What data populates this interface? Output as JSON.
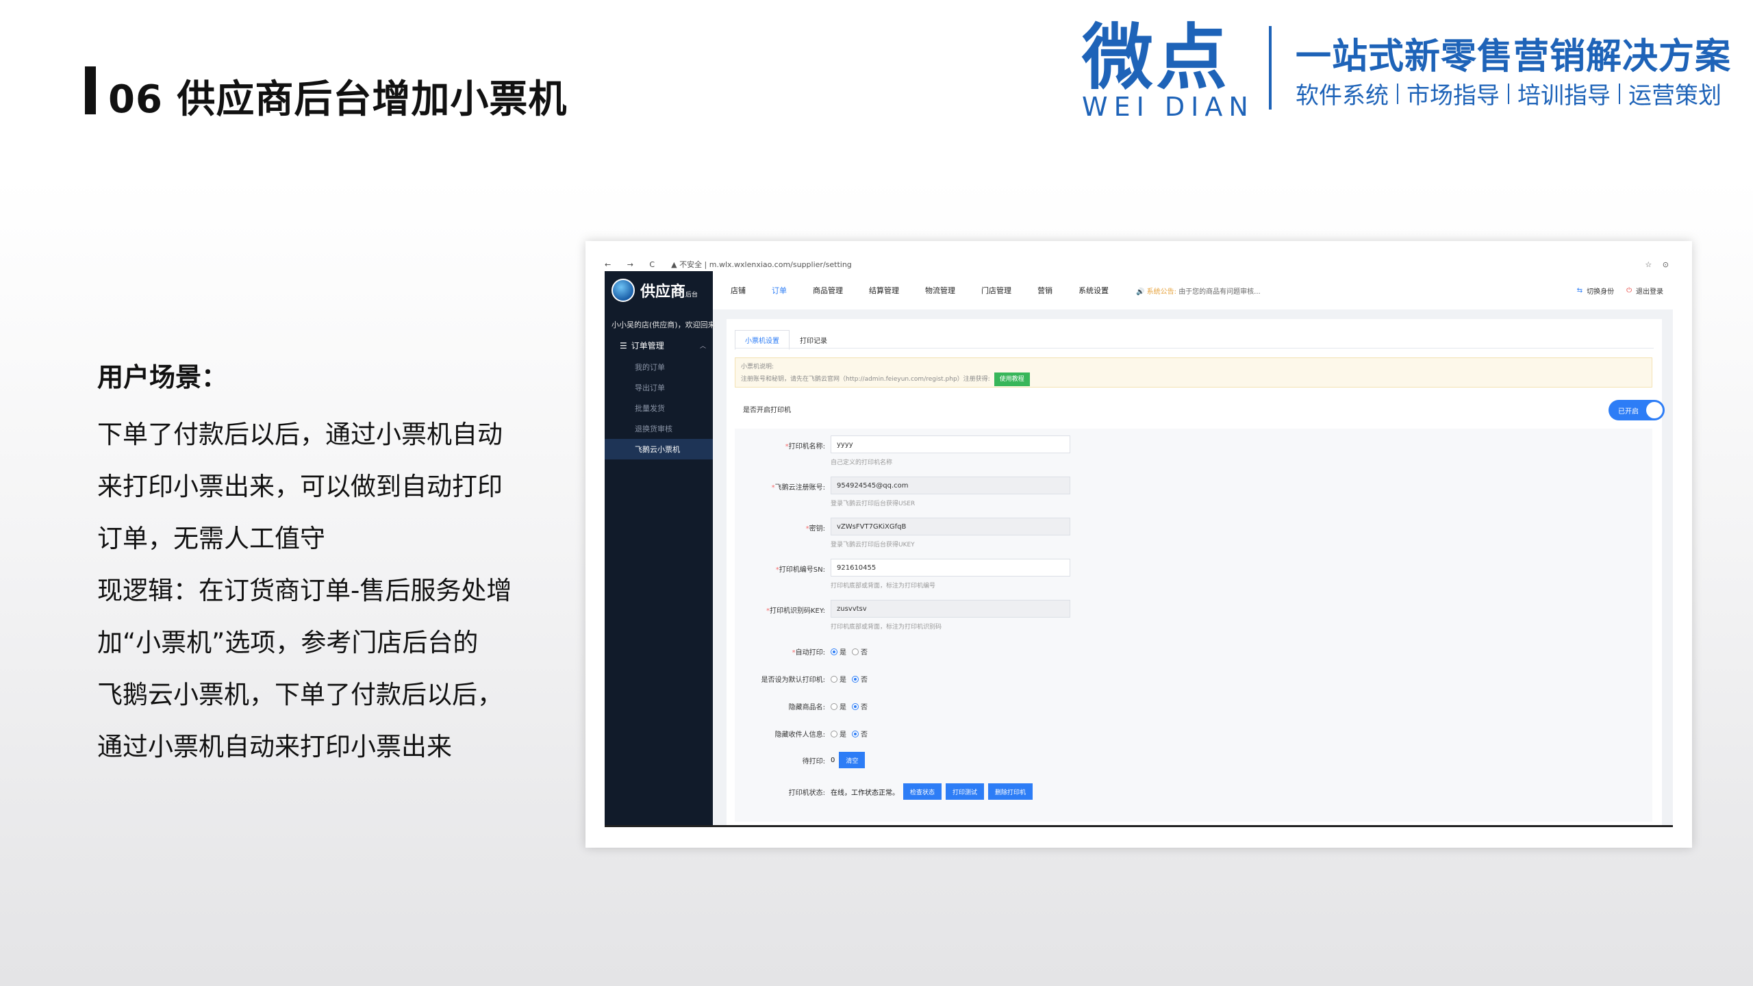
{
  "slide": {
    "title": "06 供应商后台增加小票机",
    "brand_cn": "微点",
    "brand_en": "WEI DIAN",
    "tagline": "一站式新零售营销解决方案",
    "subtags": [
      "软件系统",
      "市场指导",
      "培训指导",
      "运营策划"
    ]
  },
  "copy": {
    "heading": "用户场景：",
    "paragraphs": [
      "下单了付款后以后，通过小票机自动",
      "来打印小票出来，可以做到自动打印",
      "订单，无需人工值守",
      "现逻辑：在订货商订单-售后服务处增",
      "加“小票机”选项，参考门店后台的",
      "飞鹅云小票机，下单了付款后以后，",
      "通过小票机自动来打印小票出来"
    ]
  },
  "browser": {
    "nav": "← → C",
    "url": "▲ 不安全 | m.wlx.wxlenxiao.com/supplier/setting",
    "right": "☆ ⊙"
  },
  "app": {
    "logo_name": "供应商",
    "logo_small": "后台",
    "welcome": "小小吴的店(供应商)，欢迎回来",
    "sidebar_group": "订单管理",
    "sidebar_items": [
      "我的订单",
      "导出订单",
      "批量发货",
      "退换货审核",
      "飞鹅云小票机"
    ],
    "active_sidebar_index": 4,
    "topnav": [
      "店铺",
      "订单",
      "商品管理",
      "结算管理",
      "物流管理",
      "门店管理",
      "营销",
      "系统设置"
    ],
    "active_topnav_index": 1,
    "notice_label": "🔊 系统公告:",
    "notice_text": "由于您的商品有问题审核...",
    "switch_identity": "切换身份",
    "logout": "退出登录",
    "tabs": [
      "小票机设置",
      "打印记录"
    ],
    "info_title": "小票机说明:",
    "info_text": "注册账号和秘钥，请先在飞鹅云官网（http://admin.feieyun.com/regist.php）注册获得:",
    "info_button": "使用教程",
    "enable_label": "是否开启打印机",
    "toggle_text": "已开启",
    "fields": [
      {
        "label": "打印机名称:",
        "value": "yyyy",
        "hint": "自己定义的打印机名称",
        "disabled": false
      },
      {
        "label": "飞鹅云注册账号:",
        "value": "954924545@qq.com",
        "hint": "登录飞鹅云打印后台获得USER",
        "disabled": true
      },
      {
        "label": "密钥:",
        "value": "vZWsFVT7GKiXGfqB",
        "hint": "登录飞鹅云打印后台获得UKEY",
        "disabled": true
      },
      {
        "label": "打印机编号SN:",
        "value": "921610455",
        "hint": "打印机底部或背面，标注为打印机编号",
        "disabled": false
      },
      {
        "label": "打印机识别码KEY:",
        "value": "zusvvtsv",
        "hint": "打印机底部或背面，标注为打印机识别码",
        "disabled": true
      }
    ],
    "radios": [
      {
        "label": "自动打印:",
        "yes": "是",
        "no": "否",
        "selected": "yes"
      },
      {
        "label": "是否设为默认打印机:",
        "yes": "是",
        "no": "否",
        "selected": "no"
      },
      {
        "label": "隐藏商品名:",
        "yes": "是",
        "no": "否",
        "selected": "no"
      },
      {
        "label": "隐藏收件人信息:",
        "yes": "是",
        "no": "否",
        "selected": "no"
      }
    ],
    "pending_label": "待打印:",
    "pending_count": "0",
    "clear_button": "清空",
    "status_label": "打印机状态:",
    "status_text": "在线，工作状态正常。",
    "status_buttons": [
      "检查状态",
      "打印测试",
      "删除打印机"
    ]
  }
}
